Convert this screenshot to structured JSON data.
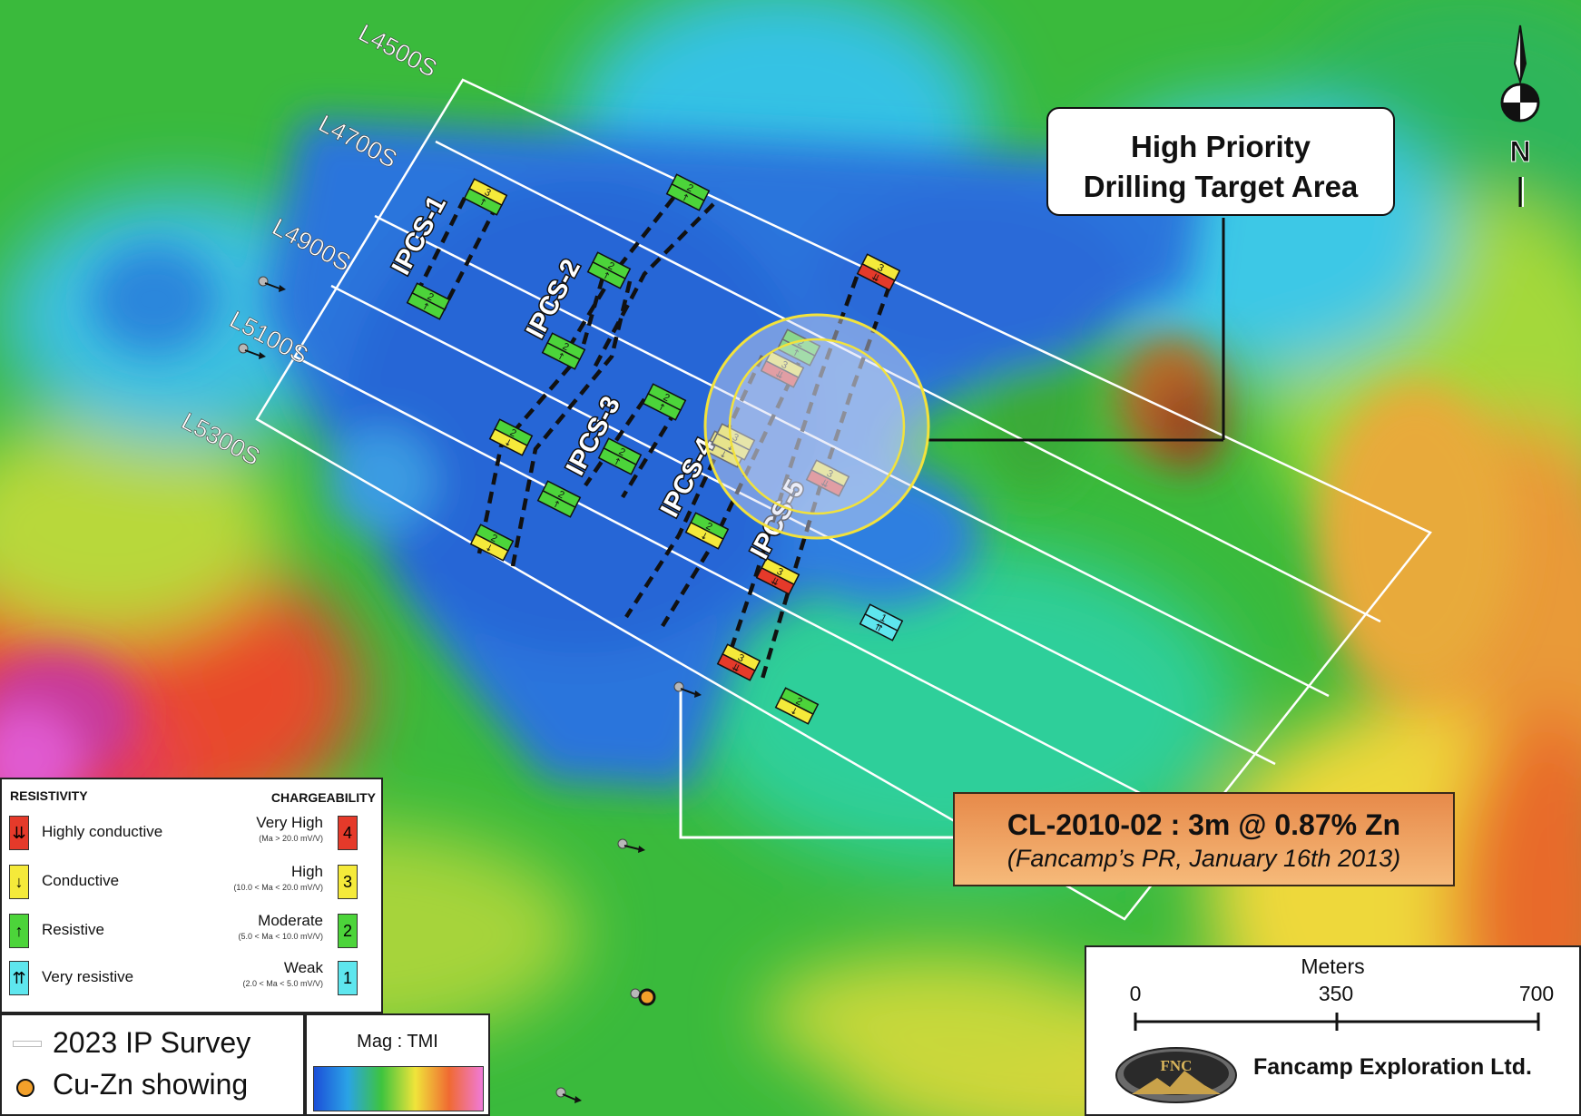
{
  "survey_lines": [
    "L4500S",
    "L4700S",
    "L4900S",
    "L5100S",
    "L5300S"
  ],
  "ipcs_labels": [
    "IPCS-1",
    "IPCS-2",
    "IPCS-3",
    "IPCS-4",
    "IPCS-5"
  ],
  "anomaly_markers": [
    {
      "res": "resistive",
      "chg": "3"
    },
    {
      "res": "resistive",
      "chg": "2"
    },
    {
      "res": "resistive",
      "chg": "2"
    },
    {
      "res": "resistive",
      "chg": "2"
    },
    {
      "res": "resistive",
      "chg": "2"
    },
    {
      "res": "conductive",
      "chg": "2"
    },
    {
      "res": "resistive",
      "chg": "2"
    },
    {
      "res": "conductive",
      "chg": "2"
    },
    {
      "res": "resistive",
      "chg": "2"
    },
    {
      "res": "resistive",
      "chg": "2"
    },
    {
      "res": "conductive",
      "chg": "3"
    },
    {
      "res": "conductive",
      "chg": "2"
    },
    {
      "res": "highly-conductive",
      "chg": "3"
    },
    {
      "res": "resistive",
      "chg": "2"
    },
    {
      "res": "highly-conductive",
      "chg": "3"
    },
    {
      "res": "conductive",
      "chg": "3"
    },
    {
      "res": "highly-conductive",
      "chg": "3"
    },
    {
      "res": "highly-conductive",
      "chg": "3"
    },
    {
      "res": "highly-conductive",
      "chg": "3"
    },
    {
      "res": "very-resistive",
      "chg": "1"
    },
    {
      "res": "conductive",
      "chg": "2"
    }
  ],
  "callouts": {
    "target": {
      "line1": "High Priority",
      "line2": "Drilling Target Area"
    },
    "drill": {
      "line1": "CL-2010-02 : 3m @ 0.87% Zn",
      "line2": "(Fancamp’s PR, January 16th 2013)"
    }
  },
  "legend": {
    "resistivity_title": "RESISTIVITY",
    "chargeability_title": "CHARGEABILITY",
    "rows": [
      {
        "res_icon": "double-down-arrow-icon",
        "res_label": "Highly conductive",
        "res_color": "#e53a2a",
        "chg_label": "Very High",
        "chg_range": "(Ma > 20.0 mV/V)",
        "chg_value": "4",
        "chg_color": "#e53a2a"
      },
      {
        "res_icon": "down-arrow-icon",
        "res_label": "Conductive",
        "res_color": "#f5ea3a",
        "chg_label": "High",
        "chg_range": "(10.0 < Ma < 20.0 mV/V)",
        "chg_value": "3",
        "chg_color": "#f5ea3a"
      },
      {
        "res_icon": "up-arrow-icon",
        "res_label": "Resistive",
        "res_color": "#4cd43a",
        "chg_label": "Moderate",
        "chg_range": "(5.0 < Ma < 10.0 mV/V)",
        "chg_value": "2",
        "chg_color": "#4cd43a"
      },
      {
        "res_icon": "double-up-arrow-icon",
        "res_label": "Very resistive",
        "res_color": "#5ee6ee",
        "chg_label": "Weak",
        "chg_range": "(2.0 < Ma < 5.0 mV/V)",
        "chg_value": "1",
        "chg_color": "#5ee6ee"
      }
    ],
    "ip_survey": "2023 IP Survey",
    "showing": "Cu-Zn showing",
    "mag_title": "Mag : TMI"
  },
  "scale_bar": {
    "title": "Meters",
    "ticks": [
      "0",
      "350",
      "700"
    ]
  },
  "company": {
    "logo_text": "FNC",
    "name": "Fancamp Exploration Ltd."
  },
  "north_arrow": {
    "label": "N"
  },
  "colors": {
    "target_circle": "#f2e23c",
    "callout_fill": "#f3a05a",
    "survey_line": "#ffffff"
  }
}
